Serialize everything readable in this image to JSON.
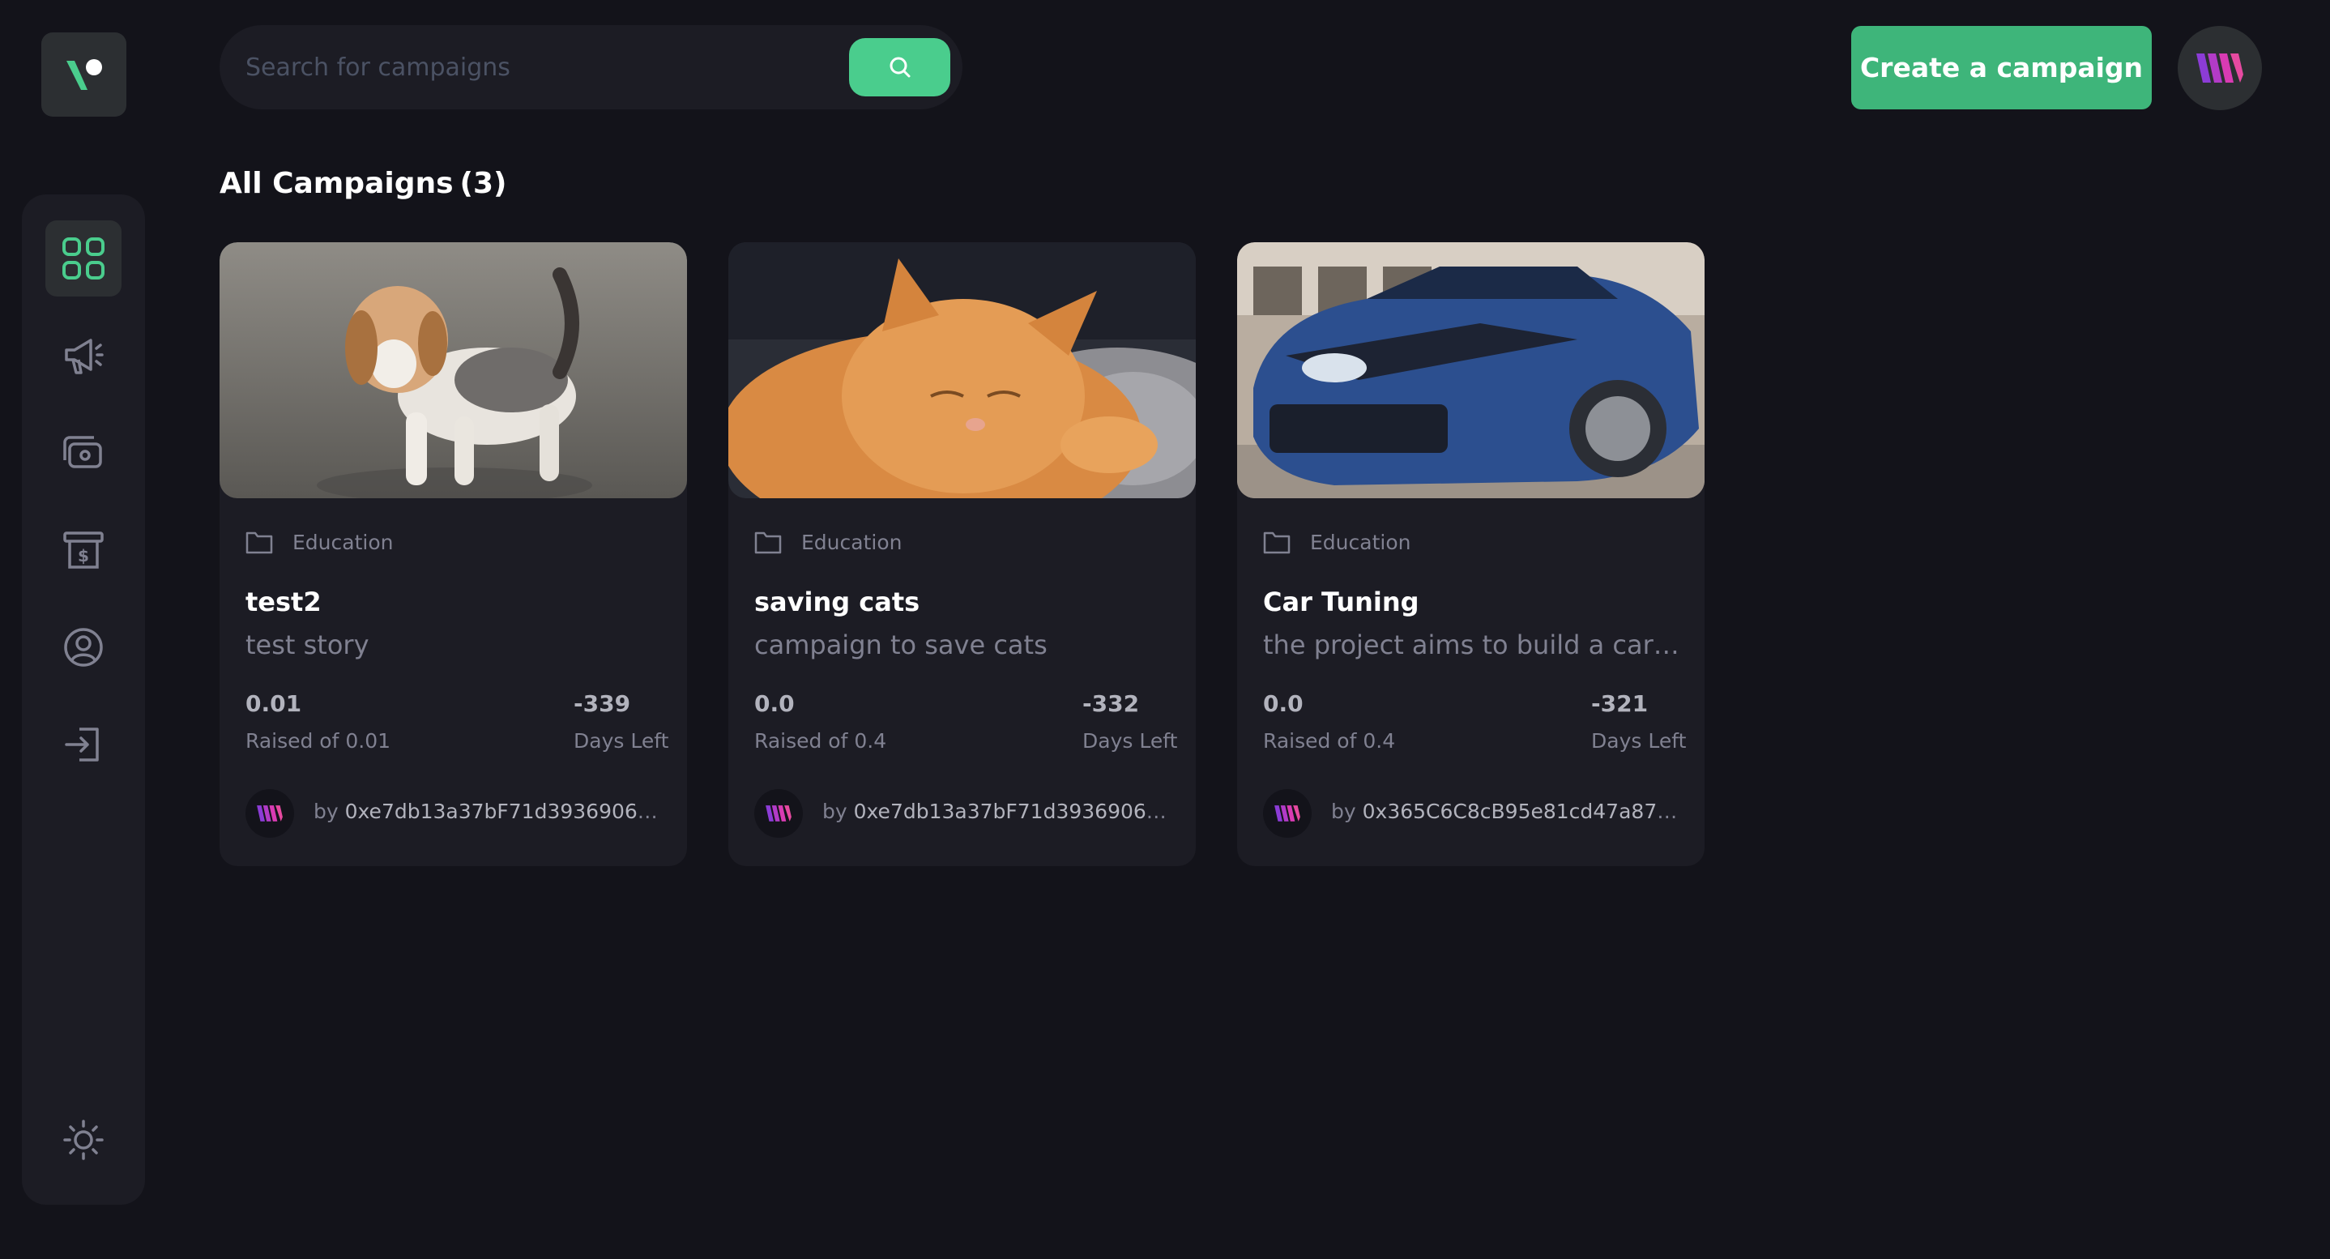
{
  "app": {
    "logo_icon": "logo-icon",
    "accent_color": "#4acd8d",
    "background_color": "#13131a",
    "card_color": "#1c1c24"
  },
  "search": {
    "placeholder": "Search for campaigns",
    "icon": "search-icon"
  },
  "header": {
    "create_label": "Create a campaign",
    "profile_icon": "profile-logo-icon"
  },
  "sidebar": {
    "items": [
      {
        "icon": "dashboard-icon",
        "active": true
      },
      {
        "icon": "campaign-icon",
        "active": false
      },
      {
        "icon": "payment-icon",
        "active": false
      },
      {
        "icon": "withdraw-icon",
        "active": false
      },
      {
        "icon": "profile-icon",
        "active": false
      },
      {
        "icon": "logout-icon",
        "active": false
      }
    ],
    "theme_icon": "sun-icon"
  },
  "main": {
    "heading": "All Campaigns",
    "count": "(3)",
    "campaigns": [
      {
        "image": "puppy photo",
        "category": "Education",
        "title": "test2",
        "description": "test story",
        "raised": "0.01",
        "raised_label": "Raised of 0.01",
        "days": "-339",
        "days_label": "Days Left",
        "by": "by",
        "owner": "0xe7db13a37bF71d3936906C8b9..."
      },
      {
        "image": "cat photo",
        "category": "Education",
        "title": "saving cats",
        "description": "campaign to save cats",
        "raised": "0.0",
        "raised_label": "Raised of 0.4",
        "days": "-332",
        "days_label": "Days Left",
        "by": "by",
        "owner": "0xe7db13a37bF71d3936906C8b9..."
      },
      {
        "image": "car photo",
        "category": "Education",
        "title": "Car Tuning",
        "description": "the project aims to build a car ...",
        "raised": "0.0",
        "raised_label": "Raised of 0.4",
        "days": "-321",
        "days_label": "Days Left",
        "by": "by",
        "owner": "0x365C6C8cB95e81cd47a8781a1..."
      }
    ]
  }
}
